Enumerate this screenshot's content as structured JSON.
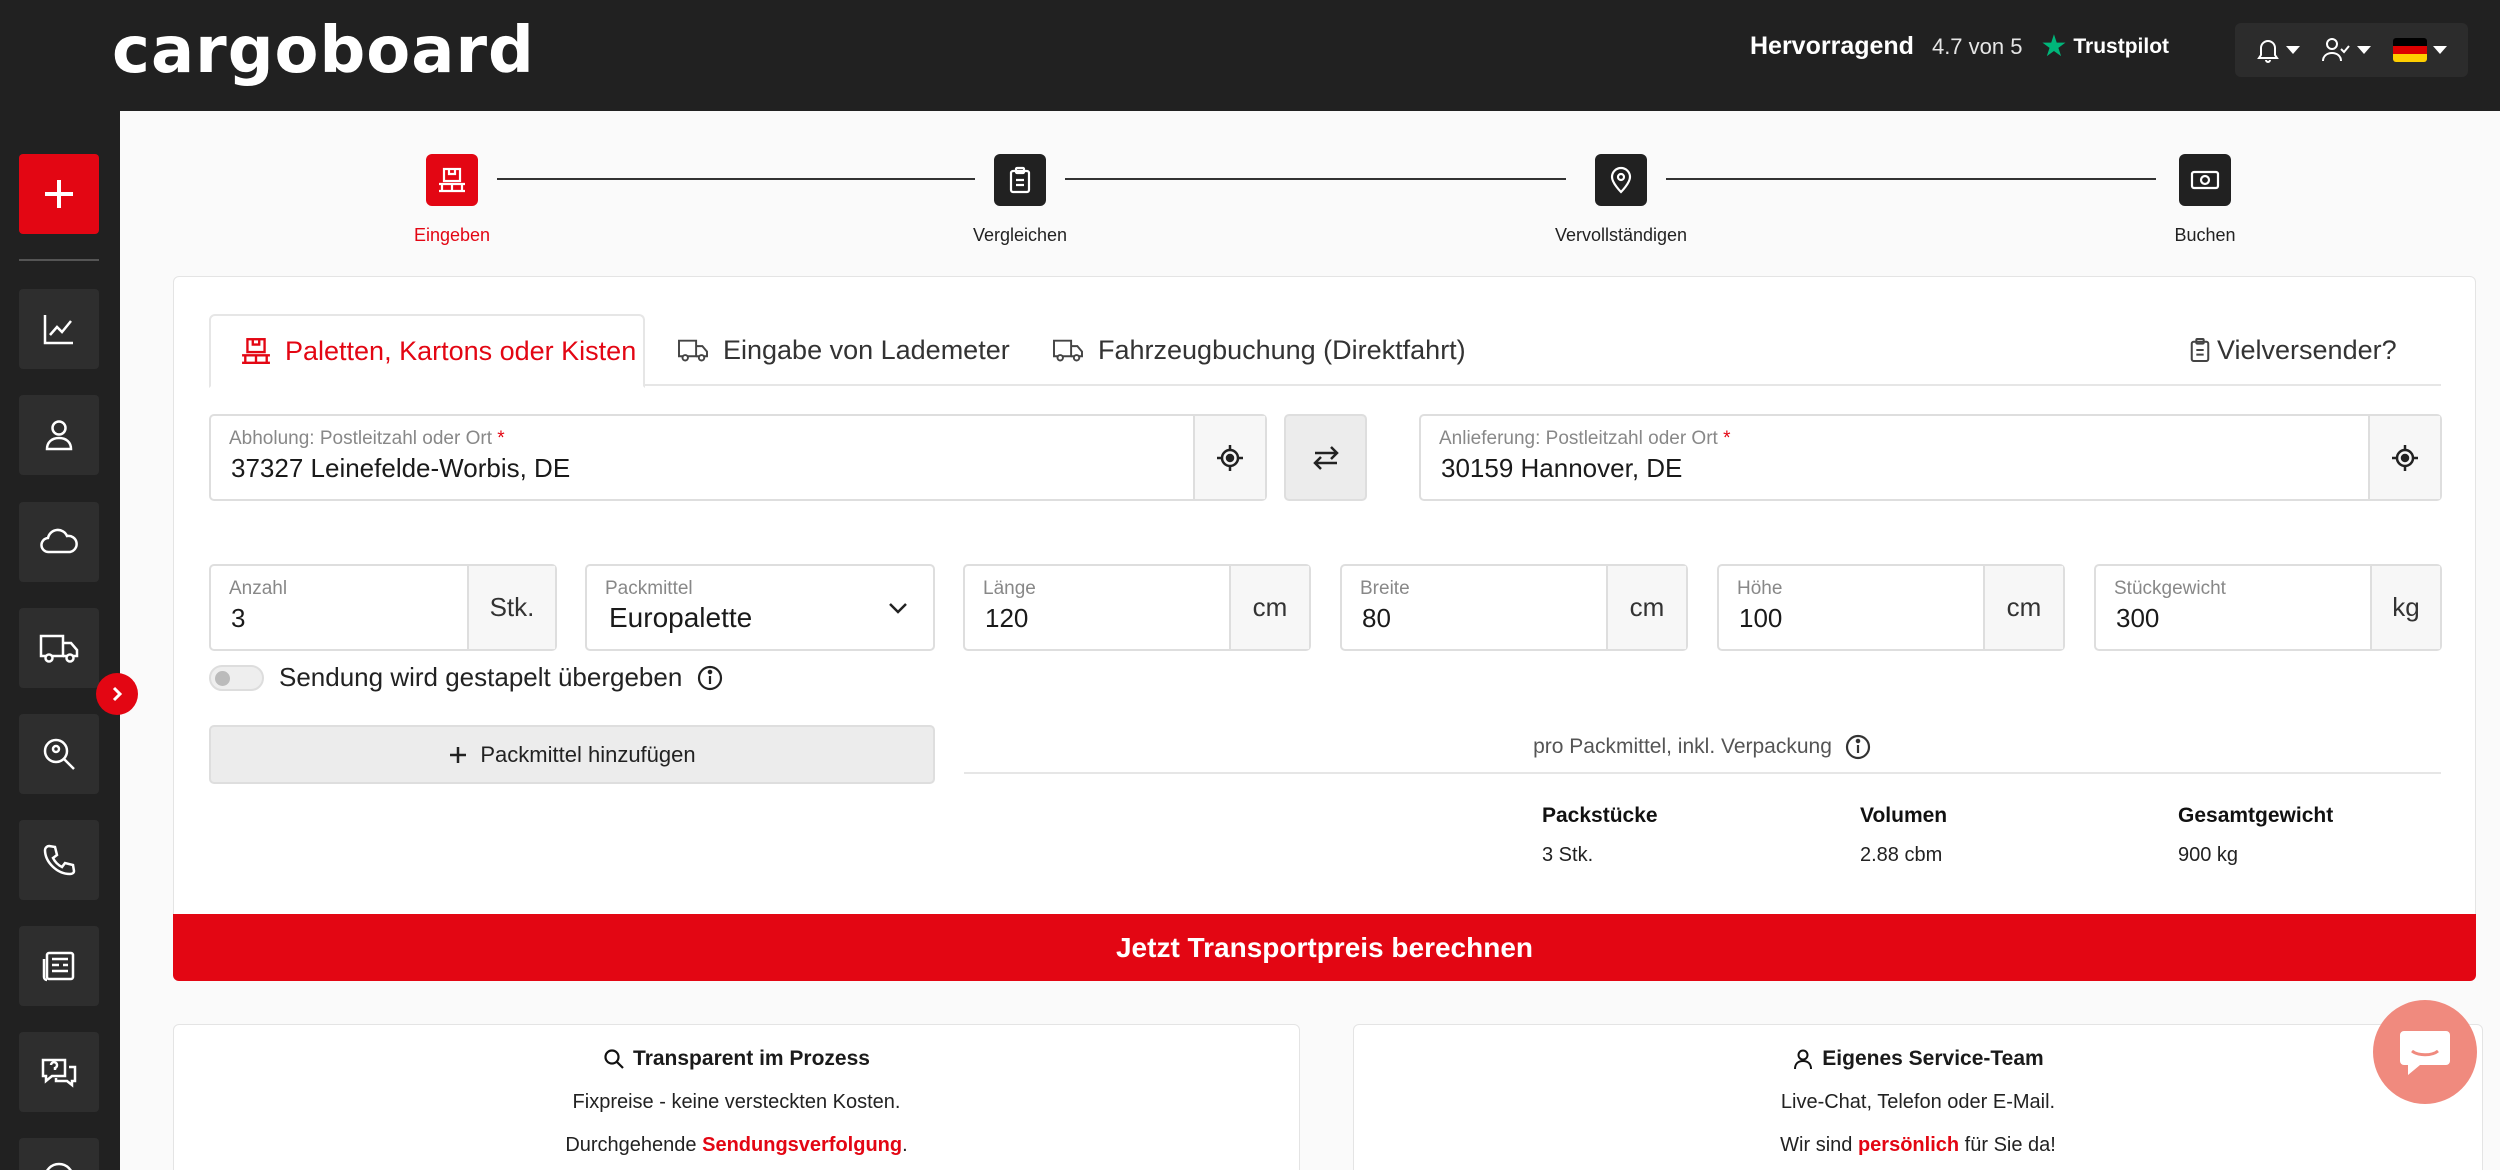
{
  "header": {
    "logo": "cargoboard",
    "trustpilot": {
      "rating_word": "Hervorragend",
      "score": "4.7 von 5",
      "brand": "Trustpilot"
    },
    "icons": [
      "bell-icon",
      "user-check-icon",
      "flag-de-icon"
    ],
    "colors": {
      "bar": "#212121",
      "accent": "#e30613",
      "trustpilot_star": "#00b67a"
    }
  },
  "sidebar": {
    "items": [
      "add-icon",
      "chart-icon",
      "user-icon",
      "cloud-icon",
      "truck-icon",
      "location-search-icon",
      "phone-icon",
      "news-icon",
      "chat-help-icon"
    ]
  },
  "stepper": {
    "steps": [
      {
        "label": "Eingeben",
        "active": true
      },
      {
        "label": "Vergleichen",
        "active": false
      },
      {
        "label": "Vervollständigen",
        "active": false
      },
      {
        "label": "Buchen",
        "active": false
      }
    ]
  },
  "tabs": {
    "pallets": "Paletten, Kartons oder Kisten",
    "loading_meter": "Eingabe von Lademeter",
    "vehicle": "Fahrzeugbuchung (Direktfahrt)",
    "frequent": "Vielversender?"
  },
  "route": {
    "pickup": {
      "label": "Abholung: Postleitzahl oder Ort",
      "required": "*",
      "value": "37327 Leinefelde-Worbis, DE"
    },
    "delivery": {
      "label": "Anlieferung: Postleitzahl oder Ort",
      "required": "*",
      "value": "30159 Hannover, DE"
    }
  },
  "package": {
    "count": {
      "label": "Anzahl",
      "value": "3",
      "unit": "Stk."
    },
    "type": {
      "label": "Packmittel",
      "value": "Europalette"
    },
    "length": {
      "label": "Länge",
      "value": "120",
      "unit": "cm"
    },
    "width": {
      "label": "Breite",
      "value": "80",
      "unit": "cm"
    },
    "height": {
      "label": "Höhe",
      "value": "100",
      "unit": "cm"
    },
    "weight": {
      "label": "Stückgewicht",
      "value": "300",
      "unit": "kg"
    }
  },
  "stacking": {
    "label": "Sendung wird gestapelt übergeben",
    "enabled": false
  },
  "add_packaging": "Packmittel hinzufügen",
  "per_pack_note": "pro Packmittel, inkl. Verpackung",
  "summary": {
    "pieces": {
      "label": "Packstücke",
      "value": "3 Stk."
    },
    "volume": {
      "label": "Volumen",
      "value": "2.88 cbm"
    },
    "total_weight": {
      "label": "Gesamtgewicht",
      "value": "900 kg"
    }
  },
  "cta": "Jetzt Transportpreis berechnen",
  "features": [
    {
      "title": "Transparent im Prozess",
      "line1": "Fixpreise - keine versteckten Kosten.",
      "line2_pre": "Durchgehende ",
      "line2_hl": "Sendungsverfolgung",
      "line2_post": "."
    },
    {
      "title": "Eigenes Service-Team",
      "line1": "Live-Chat, Telefon oder E-Mail.",
      "line2_pre": "Wir sind ",
      "line2_hl": "persönlich",
      "line2_post": " für Sie da!"
    }
  ]
}
